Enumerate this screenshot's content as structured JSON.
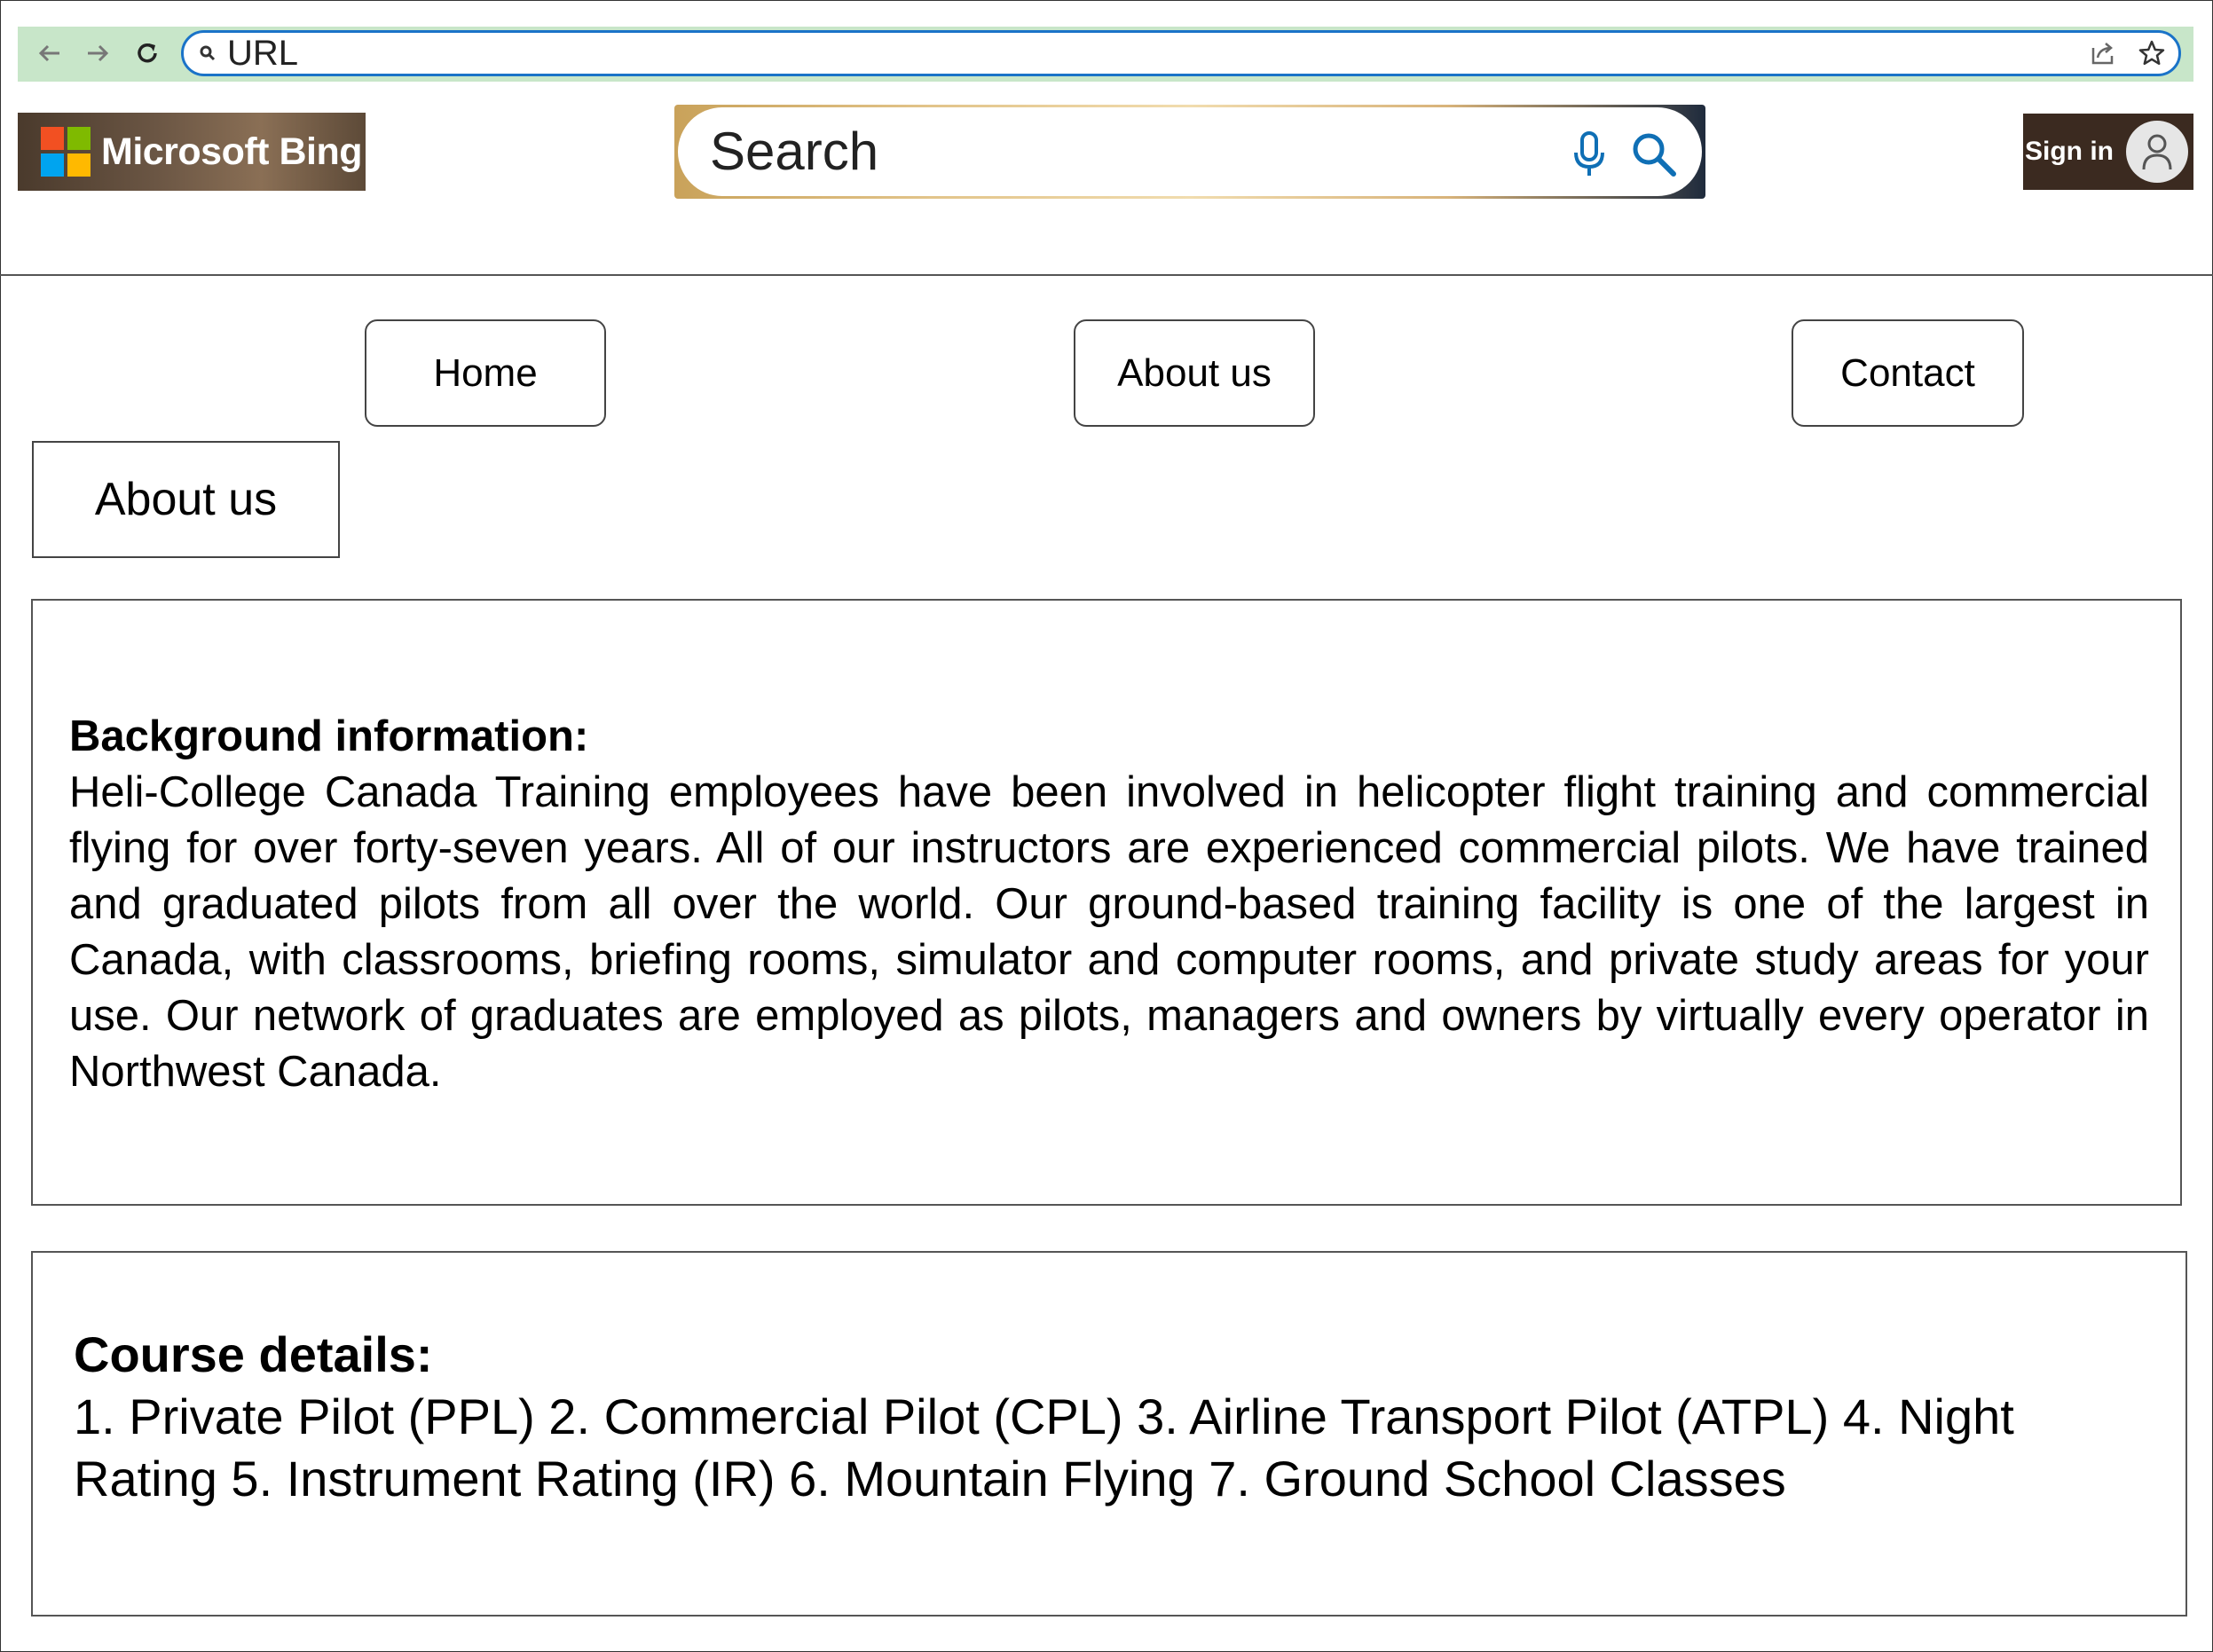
{
  "browser": {
    "url_text": "URL",
    "back_icon": "arrow-left-icon",
    "forward_icon": "arrow-right-icon",
    "reload_icon": "reload-icon",
    "share_icon": "share-icon",
    "bookmark_icon": "star-icon",
    "toolbar_color": "#c8e6c9",
    "urlbar_border_color": "#1a73c8"
  },
  "header": {
    "logo_text": "Microsoft Bing",
    "search_placeholder": "Search",
    "signin_label": "Sign in",
    "mic_icon": "microphone-icon",
    "search_icon": "search-icon",
    "accent_color": "#0f6fb5"
  },
  "nav": {
    "items": [
      {
        "label": "Home"
      },
      {
        "label": "About us"
      },
      {
        "label": "Contact"
      }
    ]
  },
  "section": {
    "tab_label": "About us"
  },
  "background": {
    "title": "Background information:",
    "body": "Heli-College Canada Training employees have been involved in helicopter flight training and commercial flying for over forty-seven years. All of our instructors are experienced commercial pilots. We have trained and graduated pilots from all over the world. Our ground-based training facility is one of the largest in Canada, with classrooms, briefing rooms, simulator and computer rooms, and private study areas for your use. Our network of graduates are employed as pilots, managers and owners by virtually every operator in Northwest Canada."
  },
  "courses": {
    "title": "Course details:",
    "body": "1. Private Pilot (PPL) 2. Commercial Pilot (CPL) 3. Airline Transport Pilot (ATPL) 4. Night Rating 5. Instrument Rating (IR) 6. Mountain Flying 7. Ground School Classes"
  }
}
